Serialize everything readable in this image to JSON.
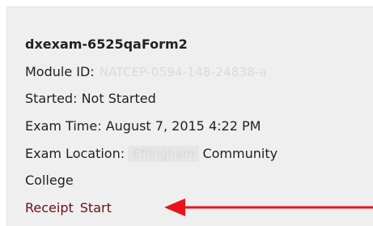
{
  "card": {
    "title": "dxexam-6525qaForm2",
    "module_label": "Module ID:",
    "module_value": "NATCEP-0594-148-24838-a",
    "started_label": "Started:",
    "started_value": "Not Started",
    "exam_time_label": "Exam Time:",
    "exam_time_value": "August 7, 2015 4:22 PM",
    "exam_location_label": "Exam Location:",
    "exam_location_redacted": "Effingham",
    "exam_location_suffix": "Community",
    "exam_location_line2": "College"
  },
  "actions": {
    "receipt_label": "Receipt",
    "start_label": "Start"
  },
  "annotation": {
    "arrow_color": "#e8141b",
    "points_to": "start-link"
  },
  "colors": {
    "card_background": "#efefef",
    "text": "#222222",
    "link": "#6a0f17"
  }
}
